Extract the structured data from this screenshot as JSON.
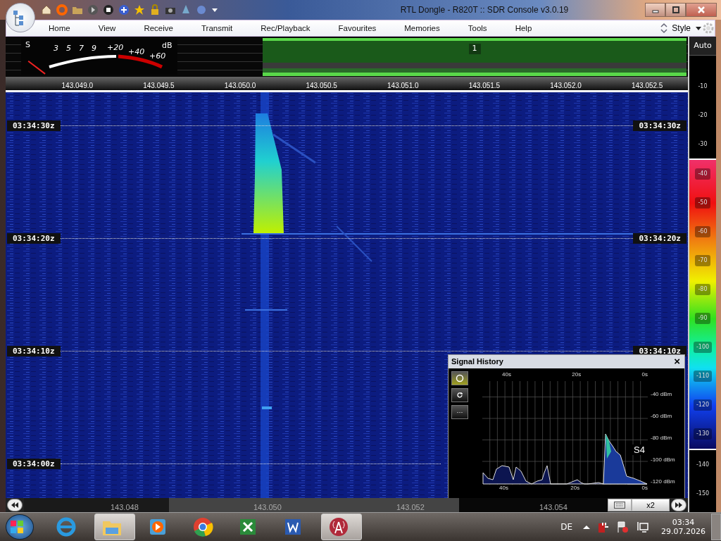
{
  "window": {
    "title": "RTL Dongle - R820T :: SDR Console v3.0.19"
  },
  "menu": [
    "Home",
    "View",
    "Receive",
    "Transmit",
    "Rec/Playback",
    "Favourites",
    "Memories",
    "Tools",
    "Help"
  ],
  "style_menu": {
    "label": "Style"
  },
  "s_meter": {
    "s_labels": [
      "S",
      "3",
      "5",
      "7",
      "9"
    ],
    "db_labels": [
      "+20",
      "+40",
      "+60"
    ],
    "unit": "dB",
    "level": 0.06
  },
  "spectrum": {
    "channel_badge": "1"
  },
  "frequency_scale": [
    "143.049.0",
    "143.049.5",
    "143.050.0",
    "143.050.5",
    "143.051.0",
    "143.051.5",
    "143.052.0",
    "143.052.5"
  ],
  "waterfall": {
    "time_labels": [
      {
        "left": "03:34:30z",
        "right": "03:34:30z"
      },
      {
        "left": "03:34:20z",
        "right": "03:34:20z"
      },
      {
        "left": "03:34:10z",
        "right": "03:34:10z"
      },
      {
        "left": "03:34:00z"
      }
    ]
  },
  "level_scale": {
    "mode": "Auto",
    "labels_above": [
      "-10",
      "-20",
      "-30"
    ],
    "labels_band": [
      "-40",
      "-50",
      "-60",
      "-70",
      "-80",
      "-90",
      "-100",
      "-110",
      "-120",
      "-130"
    ],
    "labels_below": [
      "-140",
      "-150"
    ]
  },
  "signal_history": {
    "title": "Signal History",
    "close": "×",
    "more": "···",
    "x_labels_top": [
      "40s",
      "20s",
      "0s"
    ],
    "x_labels_bottom": [
      "40s",
      "20s",
      "0s"
    ],
    "y_labels": [
      "-40 dBm",
      "-60 dBm",
      "-80 dBm",
      "-100 dBm",
      "-120 dBm"
    ],
    "readout": "S4"
  },
  "bottom_scale": {
    "labels": [
      "143.048",
      "143.050",
      "143.052",
      "143.054"
    ],
    "zoom": "x2"
  },
  "taskbar": {
    "apps": [
      {
        "kind": "browser",
        "active": false
      },
      {
        "kind": "folder",
        "active": true
      },
      {
        "kind": "media",
        "active": false
      },
      {
        "kind": "chrome",
        "active": false
      },
      {
        "kind": "sheet",
        "active": false
      },
      {
        "kind": "doc",
        "active": false
      },
      {
        "kind": "antenna",
        "active": true
      }
    ],
    "language": "DE",
    "time": "03:34",
    "date": "29.07.2026"
  }
}
